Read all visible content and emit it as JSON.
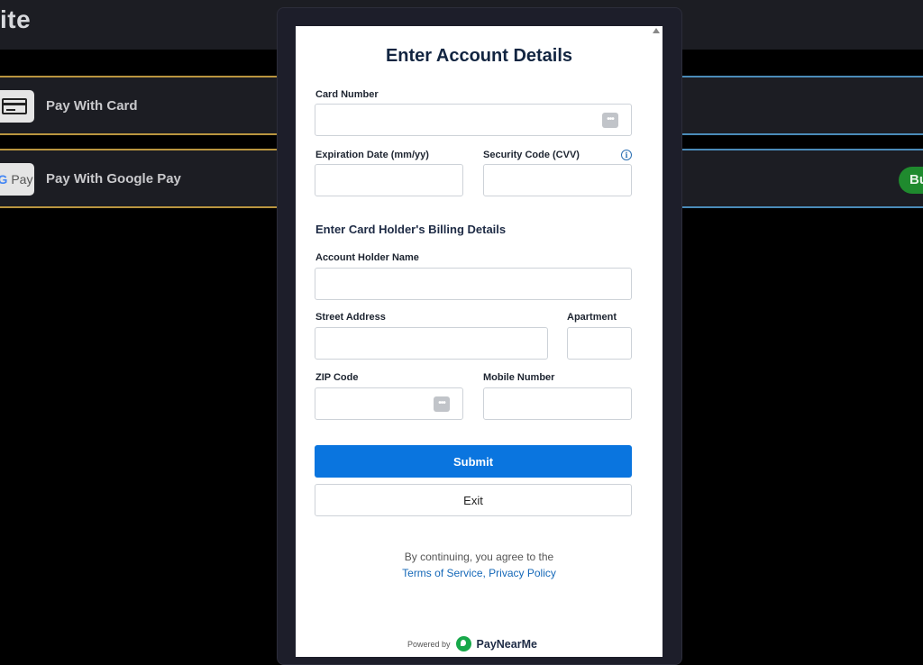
{
  "app": {
    "title_fragment": "ite",
    "pay_options": [
      {
        "label": "Pay With Card",
        "icon": "credit-card-icon"
      },
      {
        "label": "Pay With Google Pay",
        "icon": "google-pay-icon",
        "icon_text_g": "G",
        "icon_text": "Pay"
      }
    ],
    "badge": "Bu"
  },
  "modal": {
    "title": "Enter Account Details",
    "fields": {
      "card_number": {
        "label": "Card Number",
        "value": ""
      },
      "expiration": {
        "label": "Expiration Date (mm/yy)",
        "value": ""
      },
      "cvv": {
        "label": "Security Code (CVV)",
        "value": ""
      },
      "holder_name": {
        "label": "Account Holder Name",
        "value": ""
      },
      "street": {
        "label": "Street Address",
        "value": ""
      },
      "apartment": {
        "label": "Apartment",
        "value": ""
      },
      "zip": {
        "label": "ZIP Code",
        "value": ""
      },
      "mobile": {
        "label": "Mobile Number",
        "value": ""
      }
    },
    "billing_heading": "Enter Card Holder's Billing Details",
    "submit_label": "Submit",
    "exit_label": "Exit",
    "agree_text": "By continuing, you agree to the",
    "terms_link": "Terms of Service",
    "separator": ", ",
    "privacy_link": "Privacy Policy",
    "powered_by": "Powered by",
    "brand": "PayNearMe",
    "dots_icon_glyph": "•••",
    "info_icon_glyph": "i"
  },
  "colors": {
    "primary_button": "#0a75df",
    "link": "#1568b8",
    "title": "#122541",
    "brand_green": "#17a84a",
    "gold_border": "#b9953f"
  }
}
